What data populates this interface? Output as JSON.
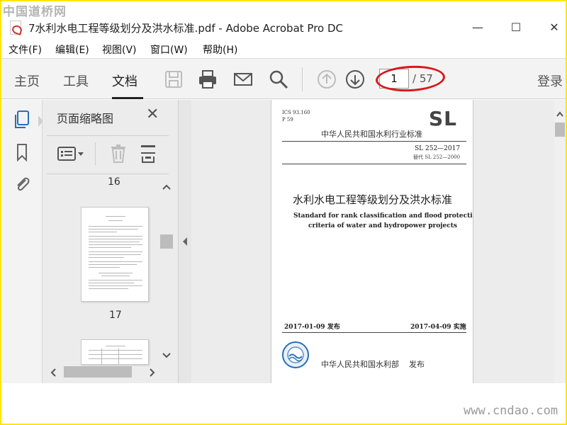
{
  "watermarks": {
    "top": "中国道桥网",
    "bottom": "www.cndao.com"
  },
  "window": {
    "title": "7水利水电工程等级划分及洪水标准.pdf - Adobe Acrobat Pro DC",
    "minimize": "—",
    "maximize": "☐",
    "close": "✕"
  },
  "menu": [
    "文件(F)",
    "编辑(E)",
    "视图(V)",
    "窗口(W)",
    "帮助(H)"
  ],
  "toolbar": {
    "tabs": [
      "主页",
      "工具",
      "文档"
    ],
    "active_tab": "文档",
    "icons": [
      "save-icon",
      "print-icon",
      "email-icon",
      "search-icon",
      "page-up-icon",
      "page-down-icon"
    ],
    "current_page": "1",
    "total_pages": "/ 57",
    "login": "登录"
  },
  "rail": {
    "icons": [
      "pages-icon",
      "bookmark-icon",
      "attachment-icon"
    ]
  },
  "thumbnails": {
    "title": "页面缩略图",
    "close": "✕",
    "page_labels": [
      "16",
      "17"
    ]
  },
  "document": {
    "ics": "ICS 93.160",
    "p_code": "P 59",
    "logo": "SL",
    "industry_standard": "中华人民共和国水利行业标准",
    "std_number": "SL 252—2017",
    "replaces": "替代 SL 252—2000",
    "title_cn": "水利水电工程等级划分及洪水标准",
    "title_en_1": "Standard for rank classification and flood protection",
    "title_en_2": "criteria of water and hydropower projects",
    "issue_date": "2017-01-09 发布",
    "impl_date": "2017-04-09 实施",
    "issuer": "中华人民共和国水利部",
    "issue_word": "发布"
  },
  "colors": {
    "accent_blue": "#2a6ebb",
    "annotation_red": "#d7191c",
    "watermark_bg": "#ffe600"
  }
}
